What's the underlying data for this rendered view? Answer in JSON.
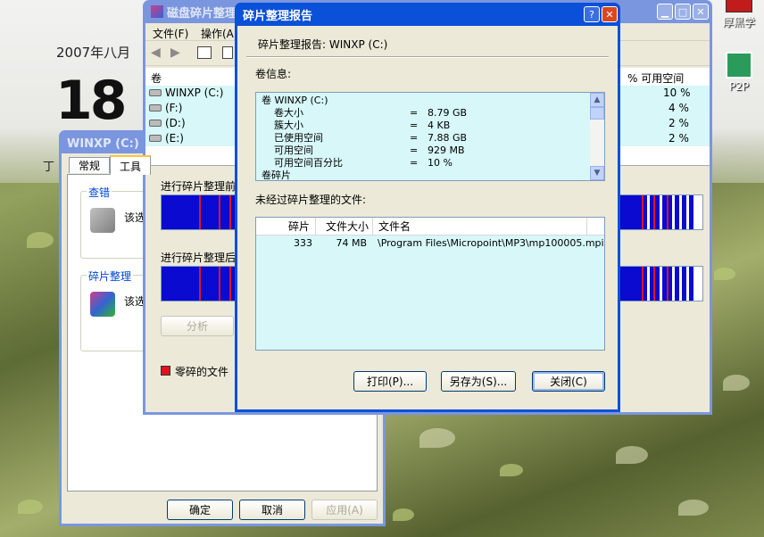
{
  "desktop": {
    "calendar_month": "2007年八月",
    "calendar_day": "18",
    "calendar_note": "丁",
    "icons": [
      {
        "label": "厚黑学",
        "icon": "red-book-icon",
        "color": "#c21b1b"
      },
      {
        "label": "P2P",
        "icon": "p2p-share-icon",
        "color": "#2a9b5a"
      }
    ]
  },
  "props_window": {
    "title": "WINXP (C:) 属性",
    "tabs": [
      "常规",
      "工具"
    ],
    "groups": [
      {
        "title": "查错",
        "text": "该选"
      },
      {
        "title": "碎片整理",
        "text": "该选"
      }
    ],
    "buttons": {
      "ok": "确定",
      "cancel": "取消",
      "apply": "应用(A)"
    }
  },
  "defrag_window": {
    "title": "磁盘碎片整理",
    "menu": [
      "文件(F)",
      "操作(A)"
    ],
    "table_headers": {
      "volume": "卷",
      "free_pct": "% 可用空间"
    },
    "volumes": [
      {
        "name": "WINXP (C:)",
        "free_pct": "10 %"
      },
      {
        "name": "(F:)",
        "free_pct": "4 %"
      },
      {
        "name": "(D:)",
        "free_pct": "2 %"
      },
      {
        "name": "(E:)",
        "free_pct": "2 %"
      }
    ],
    "before_label": "进行碎片整理前",
    "after_label": "进行碎片整理后",
    "analyze_label": "分析",
    "legend_fragmented": "零碎的文件",
    "legend_color": "#e0141e"
  },
  "report_dialog": {
    "title": "碎片整理报告",
    "help_label": "?",
    "close_label": "✕",
    "heading": "碎片整理报告: WINXP (C:)",
    "volume_info_label": "卷信息:",
    "info_lines": [
      {
        "k": "卷 WINXP (C:)",
        "eq": "",
        "v": "",
        "indent": false
      },
      {
        "k": "卷大小",
        "eq": "=",
        "v": "8.79 GB",
        "indent": true
      },
      {
        "k": "簇大小",
        "eq": "=",
        "v": "4 KB",
        "indent": true
      },
      {
        "k": "已使用空间",
        "eq": "=",
        "v": "7.88 GB",
        "indent": true
      },
      {
        "k": "可用空间",
        "eq": "=",
        "v": "929 MB",
        "indent": true
      },
      {
        "k": "可用空间百分比",
        "eq": "=",
        "v": "10 %",
        "indent": true
      },
      {
        "k": "卷碎片",
        "eq": "",
        "v": "",
        "indent": false
      }
    ],
    "undefrag_label": "未经过碎片整理的文件:",
    "file_headers": [
      "碎片",
      "文件大小",
      "文件名"
    ],
    "files": [
      {
        "frags": "333",
        "size": "74 MB",
        "name": "\\Program Files\\Micropoint\\MP3\\mp100005.mpi"
      }
    ],
    "buttons": {
      "print": "打印(P)...",
      "save_as": "另存为(S)...",
      "close": "关闭(C)"
    }
  }
}
